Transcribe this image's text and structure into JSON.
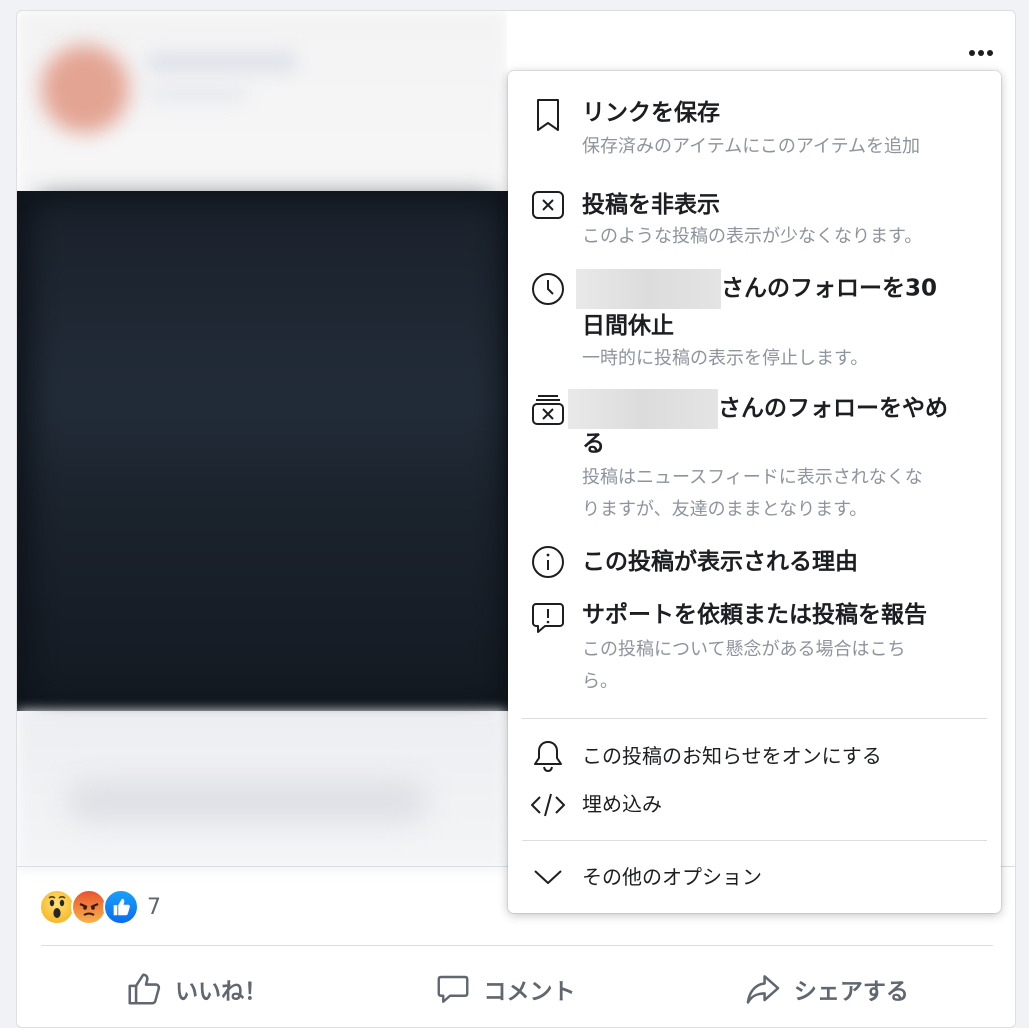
{
  "post": {
    "more_label": "•••",
    "reaction_count": "7",
    "actions": {
      "like": "いいね！",
      "comment": "コメント",
      "share": "シェアする"
    }
  },
  "menu": {
    "save_link": {
      "title": "リンクを保存",
      "desc": "保存済みのアイテムにこのアイテムを追加",
      "icon": "bookmark-icon"
    },
    "hide_post": {
      "title": "投稿を非表示",
      "desc": "このような投稿の表示が少なくなります。",
      "icon": "close-box-icon"
    },
    "snooze": {
      "title_line1": "さんのフォローを30",
      "title_line2": "日間休止",
      "desc": "一時的に投稿の表示を停止します。",
      "icon": "clock-icon"
    },
    "unfollow": {
      "title_line1": "さんのフォローをやめ",
      "title_line2": "る",
      "desc_line1": "投稿はニュースフィードに表示されなくな",
      "desc_line2": "りますが、友達のままとなります。",
      "icon": "unfollow-icon"
    },
    "why_seeing": {
      "title": "この投稿が表示される理由",
      "icon": "info-icon"
    },
    "report": {
      "title": "サポートを依頼または投稿を報告",
      "desc_line1": "この投稿について懸念がある場合はこち",
      "desc_line2": "ら。",
      "icon": "report-icon"
    },
    "notifications": {
      "label": "この投稿のお知らせをオンにする",
      "icon": "bell-icon"
    },
    "embed": {
      "label": "埋め込み",
      "icon": "code-icon"
    },
    "more_options": {
      "label": "その他のオプション",
      "icon": "chevron-down-icon"
    }
  },
  "colors": {
    "like_blue": "#1877f2",
    "secondary_text": "#8d949e",
    "menu_background": "#ffffff"
  }
}
